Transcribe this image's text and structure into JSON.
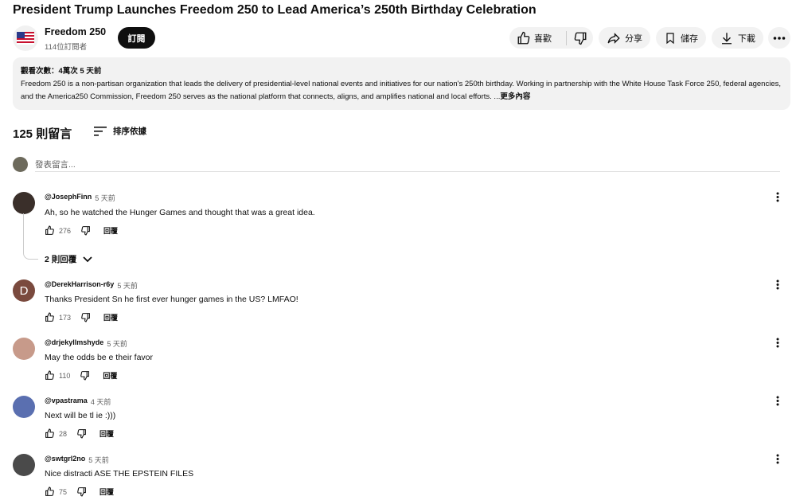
{
  "video": {
    "title": "President Trump Launches Freedom 250 to Lead America’s 250th Birthday Celebration"
  },
  "channel": {
    "name": "Freedom 250",
    "subscribers": "114位訂閱者",
    "subscribe_label": "訂閱",
    "avatar_icon": "us-flag-icon"
  },
  "actions": {
    "like_label": "喜歡",
    "share_label": "分享",
    "save_label": "儲存",
    "download_label": "下載"
  },
  "description": {
    "stats": "觀看次數：4萬次  5 天前",
    "text": "Freedom 250 is a non-partisan organization that leads the delivery of presidential-level national events and initiatives for our nation's 250th birthday. Working in partnership with the White House Task Force 250, federal agencies, and the America250 Commission, Freedom 250 serves as the national platform that connects, aligns, and amplifies national and local efforts. ...",
    "more_label": "更多內容"
  },
  "comments_header": {
    "count": "125 則留言",
    "sort_label": "排序依據",
    "add_placeholder": "發表留言..."
  },
  "comments": [
    {
      "author": "@JosephFinn",
      "time": "5 天前",
      "text": "Ah, so he watched the Hunger Games and thought that was a great idea.",
      "likes": "276",
      "reply_label": "回覆",
      "avatar_color": "#3a2f2a"
    },
    {
      "author": "@DerekHarrison-r6y",
      "time": "5 天前",
      "text": "Thanks President Sn          he first ever hunger games in the US?  LMFAO!",
      "likes": "173",
      "reply_label": "回覆",
      "avatar_letter": "D",
      "avatar_color": "#7a4a3e"
    },
    {
      "author": "@drjekyllmshyde",
      "time": "5 天前",
      "text": "May the odds be e          their favor",
      "likes": "110",
      "reply_label": "回覆",
      "avatar_color": "#c79a8a"
    },
    {
      "author": "@vpastrama",
      "time": "4 天前",
      "text": "Next will be tl          ie :)))",
      "likes": "28",
      "reply_label": "回覆",
      "avatar_color": "#5a6fb0"
    },
    {
      "author": "@swtgrl2no",
      "time": "5 天前",
      "text": "Nice distracti          ASE THE EPSTEIN FILES",
      "likes": "75",
      "reply_label": "回覆",
      "avatar_color": "#4a4a4a"
    }
  ],
  "replies_toggle": "2 則回覆"
}
